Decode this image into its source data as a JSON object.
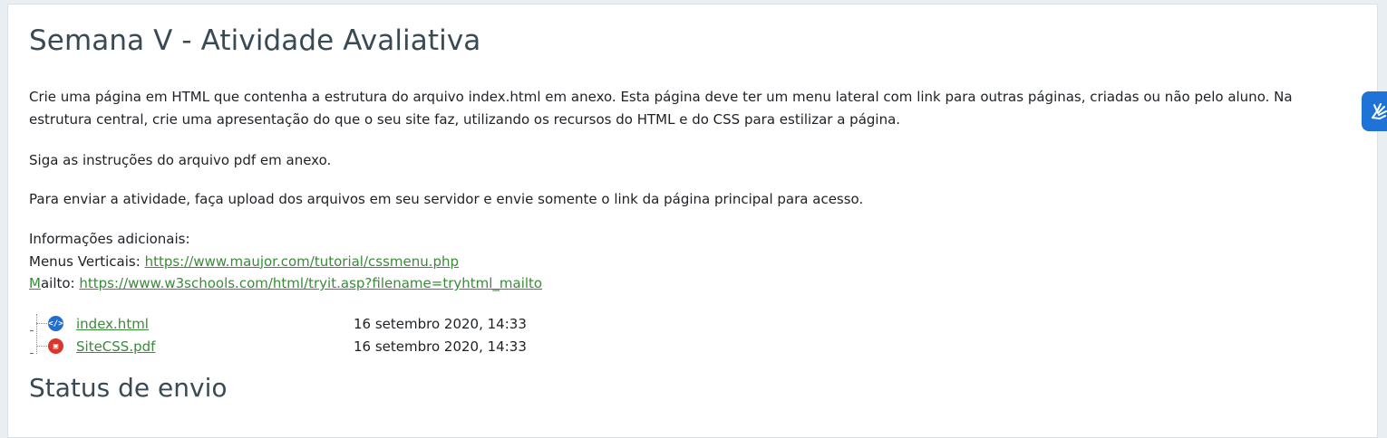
{
  "page": {
    "title": "Semana V - Atividade Avaliativa",
    "description_1": "Crie uma página em HTML que contenha a estrutura do arquivo index.html em anexo. Esta página deve ter um menu lateral com link para outras páginas, criadas ou não pelo aluno. Na estrutura central, crie uma apresentação do que o seu site faz, utilizando os recursos do HTML e do CSS para estilizar a página.",
    "description_2": "Siga as instruções do arquivo pdf em anexo.",
    "description_3": "Para enviar a atividade, faça upload dos arquivos em seu servidor e envie somente o link da página principal para acesso.",
    "info_heading": "Informações adicionais:",
    "menus_label": "Menus Verticais: ",
    "menus_link": "https://www.maujor.com/tutorial/cssmenu.php",
    "mailto_prefix": "M",
    "mailto_label": "ailto: ",
    "mailto_link": "https://www.w3schools.com/html/tryit.asp?filename=tryhtml_mailto"
  },
  "files": [
    {
      "name": "index.html",
      "date": "16 setembro 2020, 14:33",
      "icon": "html-file-icon"
    },
    {
      "name": "SiteCSS.pdf",
      "date": "16 setembro 2020, 14:33",
      "icon": "pdf-file-icon"
    }
  ],
  "status": {
    "heading": "Status de envio"
  },
  "colors": {
    "link": "#3a8a3a",
    "heading": "#3a4a55",
    "accessibility": "#1f72d6",
    "html_icon": "#1f6fd1",
    "pdf_icon": "#d7372d"
  }
}
